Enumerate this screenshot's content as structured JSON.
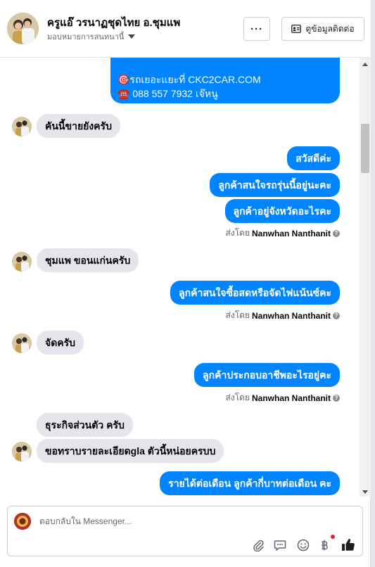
{
  "header": {
    "name": "ครูแอ๊ วรนาฏชุดไทย อ.ชุมแพ",
    "assign_label": "มอบหมายการสนทนานี้",
    "more_label": "···",
    "contact_label": "ดูข้อมูลติดต่อ"
  },
  "messages": {
    "card_line1": "🎯รถเยอะแยะที่ CKC2CAR.COM",
    "card_line2": "☎️ 088 557 7932 เจ๊หนู",
    "m1": "คันนี้ขายยังครับ",
    "m2": "สวัสดีค่ะ",
    "m3": "ลูกค้าสนใจรถรุ่นนี้อยู่นะคะ",
    "m4": "ลูกค้าอยู่จังหวัดอะไรคะ",
    "m5": "ชุมแพ ขอนแก่นครับ",
    "m6": "ลูกค้าสนใจซื้อสดหรือจัดไฟแน้นซ์คะ",
    "m7": "จัดครับ",
    "m8": "ลูกค้าประกอบอาชีพอะไรอยู่คะ",
    "m9": "ธุระกิจส่วนตัว ครับ",
    "m10": "ขอทราบรายละเอียดgla ตัวนี้หน่อยครบบ",
    "m11": "รายได้ต่อเดือน ลูกค้ากี่บาทต่อเดือน คะ",
    "sent_prefix": "ส่งโดย",
    "sent_name": "Nanwhan Nanthanit",
    "info": "?"
  },
  "composer": {
    "placeholder": "ตอบกลับใน Messenger..."
  },
  "colors": {
    "outgoing": "#0084ff",
    "incoming": "#e4e6eb",
    "notify": "#e41e3f"
  },
  "icons": [
    "more-icon",
    "contact-card-icon",
    "caret-down-icon",
    "attach-icon",
    "saved-reply-icon",
    "emoji-icon",
    "baht-icon",
    "like-icon"
  ]
}
